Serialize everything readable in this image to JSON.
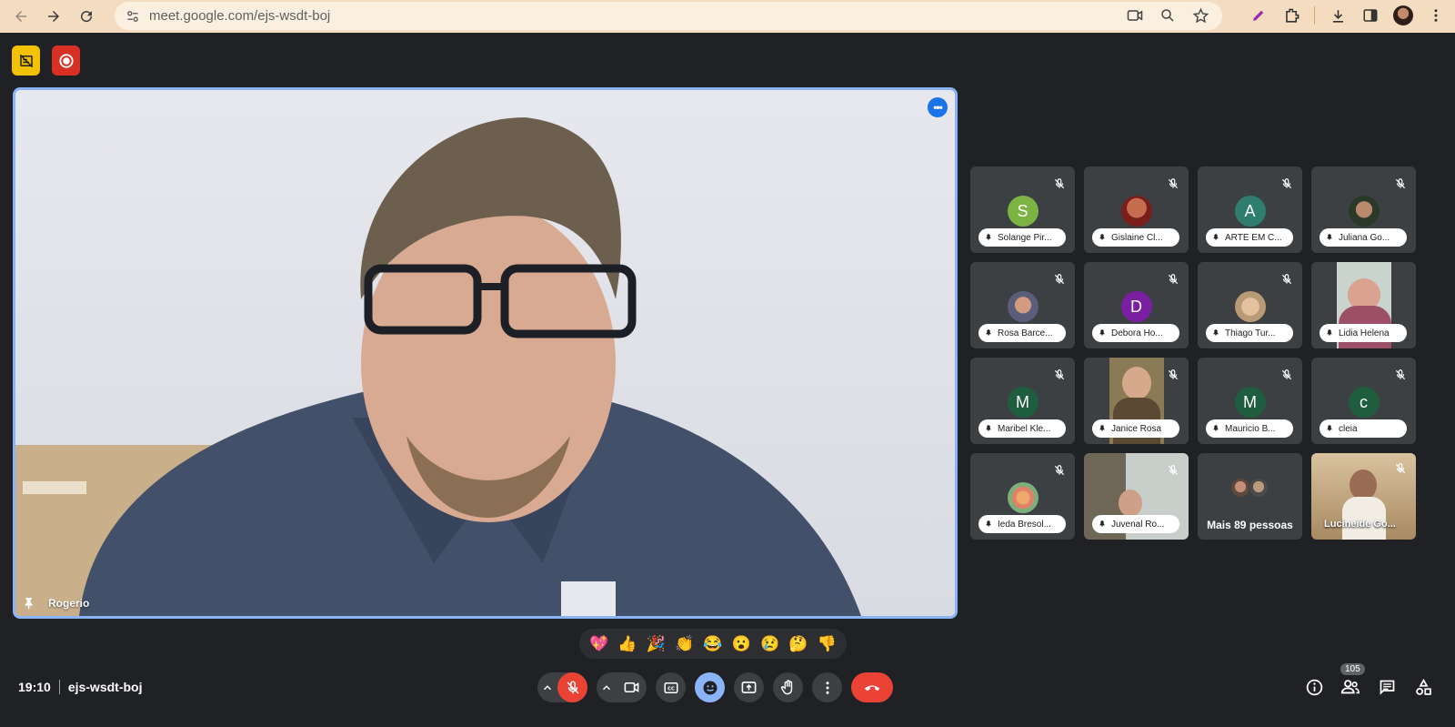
{
  "browser": {
    "url": "meet.google.com/ejs-wsdt-boj"
  },
  "main_speaker": {
    "name": "Rogerio"
  },
  "participants": [
    {
      "name": "Solange Pir...",
      "avatar_letter": "S",
      "avatar_color": "#7cb342",
      "avatar_type": "letter"
    },
    {
      "name": "Gislaine Cl...",
      "avatar_letter": "",
      "avatar_color": "#8d3b2c",
      "avatar_type": "photo"
    },
    {
      "name": "ARTE EM C...",
      "avatar_letter": "A",
      "avatar_color": "#2e7d6f",
      "avatar_type": "letter"
    },
    {
      "name": "Juliana Go...",
      "avatar_letter": "",
      "avatar_color": "#3d5a3a",
      "avatar_type": "photo"
    },
    {
      "name": "Rosa Barce...",
      "avatar_letter": "",
      "avatar_color": "#5b5e7a",
      "avatar_type": "photo"
    },
    {
      "name": "Debora Ho...",
      "avatar_letter": "D",
      "avatar_color": "#7b1fa2",
      "avatar_type": "letter"
    },
    {
      "name": "Thiago Tur...",
      "avatar_letter": "",
      "avatar_color": "#b89a76",
      "avatar_type": "photo"
    },
    {
      "name": "Lidia Helena",
      "avatar_letter": "",
      "avatar_color": "#9c6b7a",
      "avatar_type": "video"
    },
    {
      "name": "Maribel Kle...",
      "avatar_letter": "M",
      "avatar_color": "#1e5e3e",
      "avatar_type": "letter"
    },
    {
      "name": "Janice Rosa",
      "avatar_letter": "",
      "avatar_color": "#6e5a3f",
      "avatar_type": "video"
    },
    {
      "name": "Mauricio B...",
      "avatar_letter": "M",
      "avatar_color": "#1e5e3e",
      "avatar_type": "letter"
    },
    {
      "name": "cleia",
      "avatar_letter": "c",
      "avatar_color": "#1e5e3e",
      "avatar_type": "letter"
    },
    {
      "name": "Ieda Bresol...",
      "avatar_letter": "",
      "avatar_color": "#e8e0d8",
      "avatar_type": "photo"
    },
    {
      "name": "Juvenal Ro...",
      "avatar_letter": "",
      "avatar_color": "#8a8f8c",
      "avatar_type": "video"
    },
    {
      "name": "Mais 89 pessoas",
      "avatar_letter": "",
      "avatar_color": "#3c4043",
      "avatar_type": "more"
    },
    {
      "name": "Lucineide Go...",
      "avatar_letter": "",
      "avatar_color": "#b79a6e",
      "avatar_type": "video"
    }
  ],
  "reactions": [
    "💖",
    "👍",
    "🎉",
    "👏",
    "😂",
    "😮",
    "😢",
    "🤔",
    "👎"
  ],
  "meeting": {
    "time": "19:10",
    "code": "ejs-wsdt-boj"
  },
  "people_count": "105",
  "colors": {
    "background": "#202124",
    "accent": "#8ab4f8",
    "end_call": "#ea4335",
    "browser_bar": "#f3dcc0"
  }
}
